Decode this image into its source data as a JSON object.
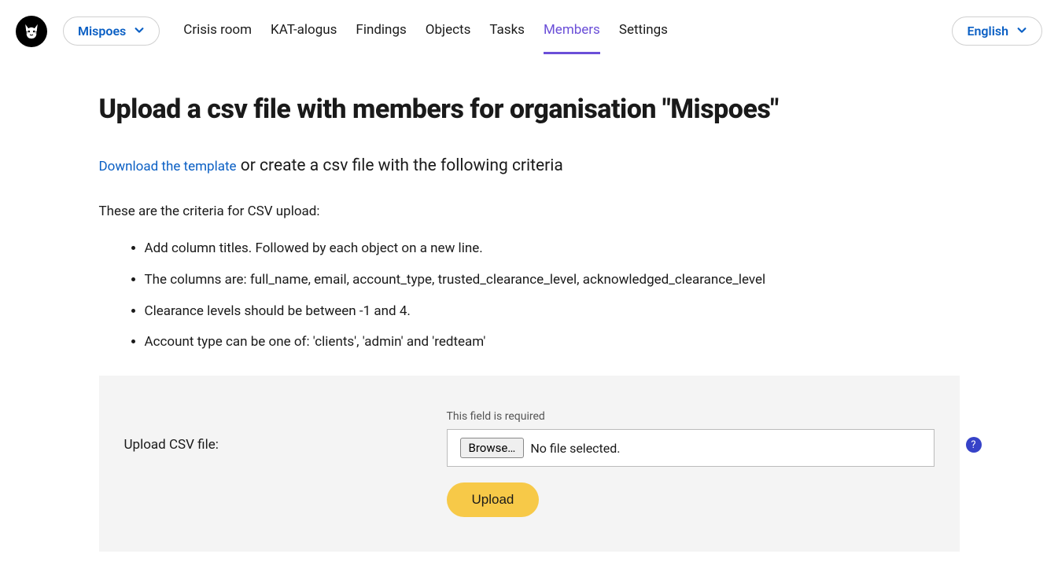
{
  "header": {
    "org_name": "Mispoes",
    "language": "English",
    "nav_items": [
      {
        "label": "Crisis room",
        "active": false
      },
      {
        "label": "KAT-alogus",
        "active": false
      },
      {
        "label": "Findings",
        "active": false
      },
      {
        "label": "Objects",
        "active": false
      },
      {
        "label": "Tasks",
        "active": false
      },
      {
        "label": "Members",
        "active": true
      },
      {
        "label": "Settings",
        "active": false
      }
    ]
  },
  "page": {
    "title": "Upload a csv file with members for organisation \"Mispoes\"",
    "download_link": "Download the template",
    "subtext_rest": " or create a csv file with the following criteria",
    "criteria_label": "These are the criteria for CSV upload:",
    "criteria": [
      "Add column titles. Followed by each object on a new line.",
      "The columns are: full_name, email, account_type, trusted_clearance_level, acknowledged_clearance_level",
      "Clearance levels should be between -1 and 4.",
      "Account type can be one of: 'clients', 'admin' and 'redteam'"
    ]
  },
  "form": {
    "upload_label": "Upload CSV file:",
    "required_note": "This field is required",
    "browse_label": "Browse…",
    "file_status": "No file selected.",
    "upload_button": "Upload",
    "help_symbol": "?"
  }
}
